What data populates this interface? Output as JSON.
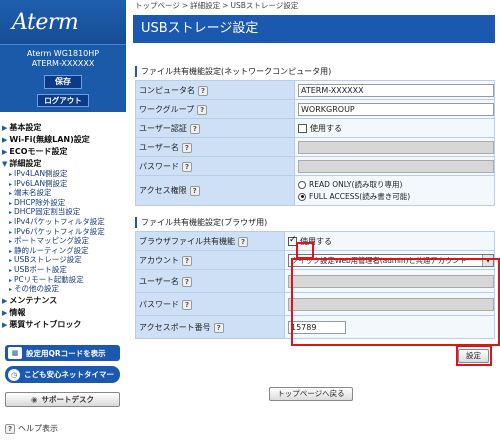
{
  "sidebar": {
    "logo": "Aterm",
    "model": "Aterm WG1810HP",
    "device_id": "ATERM-XXXXXX",
    "save_label": "保存",
    "logout_label": "ログアウト",
    "menu": [
      {
        "label": "基本設定",
        "children": []
      },
      {
        "label": "Wi-Fi(無線LAN)設定",
        "children": []
      },
      {
        "label": "ECOモード設定",
        "children": []
      },
      {
        "label": "詳細設定",
        "children": [
          "IPv4LAN側設定",
          "IPv6LAN側設定",
          "端末名設定",
          "DHCP除外設定",
          "DHCP固定割当設定",
          "IPv4パケットフィルタ設定",
          "IPv6パケットフィルタ設定",
          "ポートマッピング設定",
          "静的ルーティング設定",
          "USBストレージ設定",
          "USBポート設定",
          "PCリモート起動設定",
          "その他の設定"
        ]
      },
      {
        "label": "メンテナンス",
        "children": []
      },
      {
        "label": "情報",
        "children": []
      },
      {
        "label": "悪質サイトブロック",
        "children": []
      }
    ],
    "qr_button": "設定用QRコードを表示",
    "kids_button": "こども安心ネットタイマー",
    "support_button": "サポートデスク",
    "help_link": "ヘルプ表示"
  },
  "breadcrumb": [
    "トップページ",
    "詳細設定",
    "USBストレージ設定"
  ],
  "breadcrumb_sep": ">",
  "page_title": "USBストレージ設定",
  "network_section": {
    "heading": "ファイル共有機能設定(ネットワークコンピュータ用)",
    "computer_name_label": "コンピュータ名",
    "computer_name_value": "ATERM-XXXXXX",
    "workgroup_label": "ワークグループ",
    "workgroup_value": "WORKGROUP",
    "user_auth_label": "ユーザー認証",
    "user_auth_option": "使用する",
    "username_label": "ユーザー名",
    "password_label": "パスワード",
    "access_label": "アクセス権限",
    "access_readonly": "READ ONLY(読み取り専用)",
    "access_full": "FULL ACCESS(読み書き可能)"
  },
  "browser_section": {
    "heading": "ファイル共有機能設定(ブラウザ用)",
    "browser_share_label": "ブラウザファイル共有機能",
    "browser_share_option": "使用する",
    "account_label": "アカウント",
    "account_value": "クイック設定Web用管理者(admin)と共通アカウント",
    "username_label": "ユーザー名",
    "password_label": "パスワード",
    "port_label": "アクセスポート番号",
    "port_value": "15789"
  },
  "help_mark": "?",
  "settings_button": "設定",
  "back_button": "トップページへ戻る",
  "colors": {
    "brand_blue": "#1b58b0",
    "highlight_red": "#e0131c",
    "label_bg": "#cde0f5"
  },
  "icons": [
    "help-icon",
    "arrow-icon",
    "checkbox-icon",
    "radio-icon",
    "dropdown-arrow-icon",
    "qr-code-icon",
    "clock-icon",
    "headset-icon"
  ]
}
